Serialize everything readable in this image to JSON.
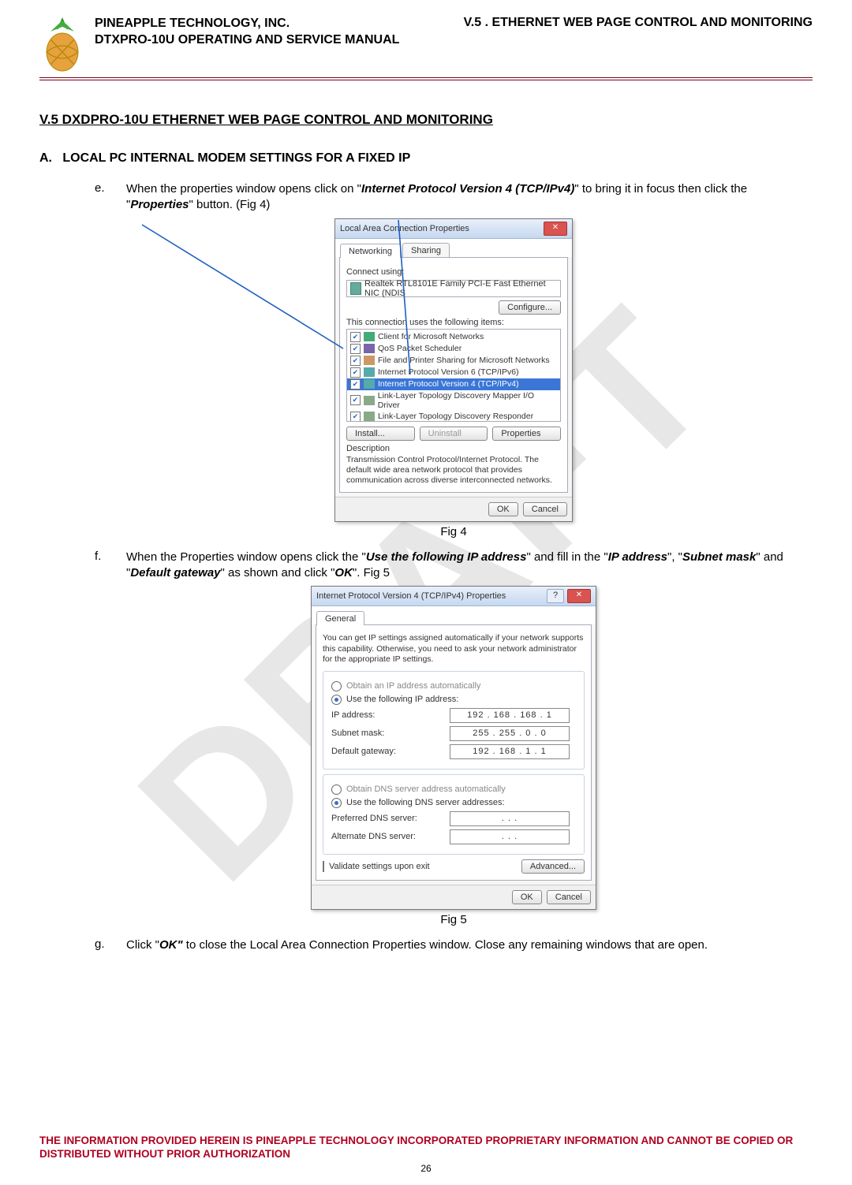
{
  "header": {
    "company": "PINEAPPLE TECHNOLOGY, INC.",
    "manual": "DTXPRO-10U OPERATING AND SERVICE MANUAL",
    "chapter": "V.5 . ETHERNET WEB PAGE CONTROL AND MONITORING"
  },
  "watermark": "DRAFT",
  "section_title": "V.5 DXDPRO-10U ETHERNET WEB PAGE CONTROL AND MONITORING",
  "subsection": {
    "letter": "A.",
    "title": "LOCAL PC INTERNAL MODEM SETTINGS FOR A FIXED IP"
  },
  "steps": {
    "e": {
      "marker": "e.",
      "pre": "When the properties window opens click on \"",
      "em1": "Internet Protocol Version 4 (TCP/IPv4)",
      "mid": "\" to bring it in focus then click the \"",
      "em2": "Properties",
      "post": "\" button. (Fig 4)"
    },
    "f": {
      "marker": "f.",
      "pre": "When the Properties window opens click the \"",
      "em1": "Use the following IP address",
      "mid1": "\" and fill in the \"",
      "em2": "IP address",
      "mid2": "\", \"",
      "em3": "Subnet mask",
      "mid3": "\" and \"",
      "em4": "Default gateway",
      "mid4": "\" as shown and click \"",
      "em5": "OK",
      "post": "\". Fig 5"
    },
    "g": {
      "marker": "g.",
      "pre": "Click \"",
      "em1": "OK\"",
      "post": " to close the Local Area Connection Properties window.  Close any remaining windows that are open."
    }
  },
  "fig4": {
    "caption": "Fig 4",
    "title": "Local Area Connection Properties",
    "tabs": [
      "Networking",
      "Sharing"
    ],
    "connect_label": "Connect using:",
    "adapter": "Realtek RTL8101E Family PCI-E Fast Ethernet NIC (NDIS",
    "configure": "Configure...",
    "uses_label": "This connection uses the following items:",
    "items": [
      {
        "c": true,
        "t": "Client for Microsoft Networks"
      },
      {
        "c": true,
        "t": "QoS Packet Scheduler"
      },
      {
        "c": true,
        "t": "File and Printer Sharing for Microsoft Networks"
      },
      {
        "c": true,
        "t": "Internet Protocol Version 6 (TCP/IPv6)"
      },
      {
        "c": true,
        "t": "Internet Protocol Version 4 (TCP/IPv4)",
        "sel": true
      },
      {
        "c": true,
        "t": "Link-Layer Topology Discovery Mapper I/O Driver"
      },
      {
        "c": true,
        "t": "Link-Layer Topology Discovery Responder"
      }
    ],
    "install": "Install...",
    "uninstall": "Uninstall",
    "properties": "Properties",
    "desc_label": "Description",
    "desc": "Transmission Control Protocol/Internet Protocol. The default wide area network protocol that provides communication across diverse interconnected networks.",
    "ok": "OK",
    "cancel": "Cancel"
  },
  "fig5": {
    "caption": "Fig 5",
    "title": "Internet Protocol Version 4 (TCP/IPv4) Properties",
    "tab": "General",
    "intro": "You can get IP settings assigned automatically if your network supports this capability. Otherwise, you need to ask your network administrator for the appropriate IP settings.",
    "r_auto_ip": "Obtain an IP address automatically",
    "r_use_ip": "Use the following IP address:",
    "ip_label": "IP address:",
    "ip": "192 . 168 . 168 .   1",
    "sm_label": "Subnet mask:",
    "sm": "255 . 255 .  0  .   0",
    "gw_label": "Default gateway:",
    "gw": "192 . 168 .   1   .   1",
    "r_auto_dns": "Obtain DNS server address automatically",
    "r_use_dns": "Use the following DNS server addresses:",
    "pdns_label": "Preferred DNS server:",
    "pdns": ".       .       .",
    "adns_label": "Alternate DNS server:",
    "adns": ".       .       .",
    "validate": "Validate settings upon exit",
    "advanced": "Advanced...",
    "ok": "OK",
    "cancel": "Cancel"
  },
  "footer": {
    "disclaimer": "THE INFORMATION PROVIDED HEREIN IS PINEAPPLE TECHNOLOGY INCORPORATED PROPRIETARY INFORMATION AND CANNOT BE COPIED OR DISTRIBUTED WITHOUT PRIOR AUTHORIZATION",
    "page": "26"
  }
}
